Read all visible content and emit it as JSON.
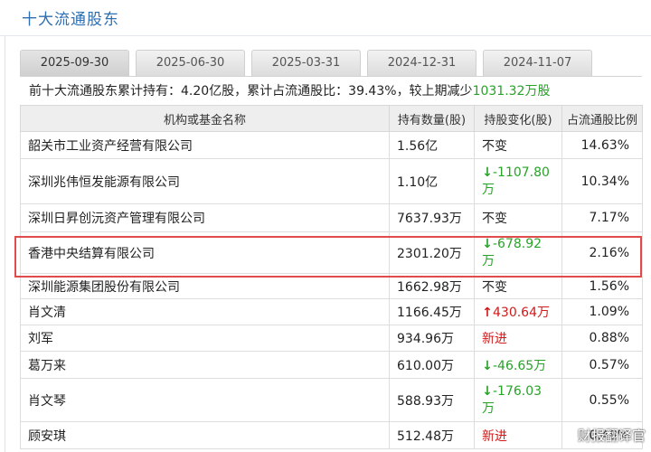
{
  "panel": {
    "title": "十大流通股东"
  },
  "tabs": [
    {
      "label": "2025-09-30",
      "active": true
    },
    {
      "label": "2025-06-30",
      "active": false
    },
    {
      "label": "2025-03-31",
      "active": false
    },
    {
      "label": "2024-12-31",
      "active": false
    },
    {
      "label": "2024-11-07",
      "active": false
    }
  ],
  "summary": {
    "prefix": "前十大流通股东累计持有：",
    "shares": "4.20亿股",
    "ratio_label": "，累计占流通股比：",
    "ratio": "39.43%",
    "change_label": "，较上期减少",
    "change_value": "1031.32万股"
  },
  "table": {
    "headers": {
      "name": "机构或基金名称",
      "amount": "持有数量(股)",
      "change": "持股变化(股)",
      "pct": "占流通股比例"
    },
    "rows": [
      {
        "name": "韶关市工业资产经营有限公司",
        "amount": "1.56亿",
        "change": "不变",
        "dir": "same",
        "pct": "14.63%"
      },
      {
        "name": "深圳兆伟恒发能源有限公司",
        "amount": "1.10亿",
        "change": "-1107.80万",
        "dir": "down",
        "pct": "10.34%"
      },
      {
        "name": "深圳日昇创沅资产管理有限公司",
        "amount": "7637.93万",
        "change": "不变",
        "dir": "same",
        "pct": "7.17%"
      },
      {
        "name": "香港中央结算有限公司",
        "amount": "2301.20万",
        "change": "-678.92万",
        "dir": "down",
        "pct": "2.16%"
      },
      {
        "name": "深圳能源集团股份有限公司",
        "amount": "1662.98万",
        "change": "不变",
        "dir": "same",
        "pct": "1.56%"
      },
      {
        "name": "肖文清",
        "amount": "1166.45万",
        "change": "430.64万",
        "dir": "up",
        "pct": "1.09%"
      },
      {
        "name": "刘军",
        "amount": "934.96万",
        "change": "新进",
        "dir": "new",
        "pct": "0.88%"
      },
      {
        "name": "葛万来",
        "amount": "610.00万",
        "change": "-46.65万",
        "dir": "down",
        "pct": "0.57%"
      },
      {
        "name": "肖文琴",
        "amount": "588.93万",
        "change": "-176.03万",
        "dir": "down",
        "pct": "0.55%"
      },
      {
        "name": "顾安琪",
        "amount": "512.48万",
        "change": "新进",
        "dir": "new",
        "pct": "0.48%"
      }
    ]
  },
  "icons": {
    "down": "down-arrow-icon",
    "up": "up-arrow-icon"
  },
  "colors": {
    "title": "#2d6fb3",
    "decrease": "#27a327",
    "increase": "#d11a1a",
    "highlight": "#e24b4b"
  },
  "watermark": "财报翻译官"
}
